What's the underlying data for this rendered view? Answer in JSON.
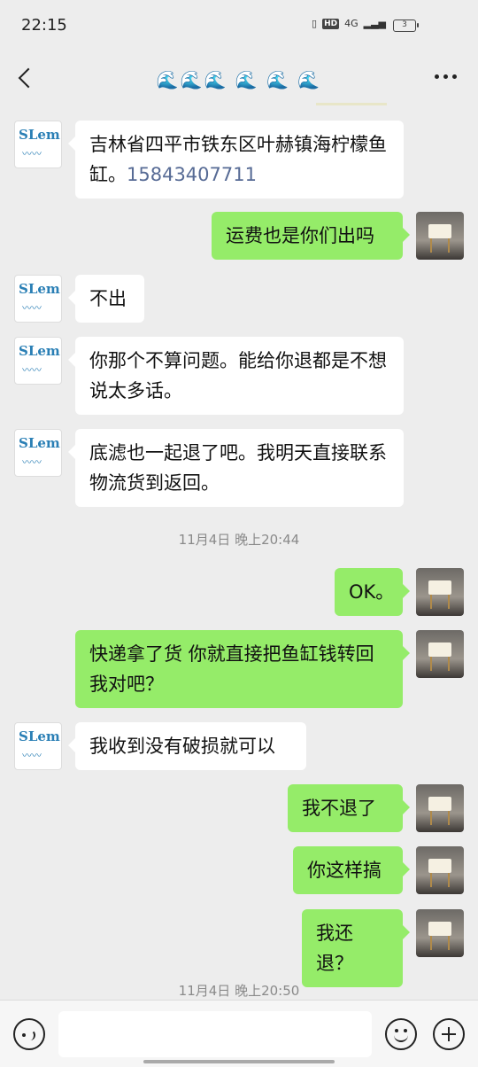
{
  "status": {
    "time": "22:15",
    "network": "4G",
    "battery": "3"
  },
  "header": {
    "title": "🌊🌊🌊 🌊 🌊 🌊"
  },
  "messages": [
    {
      "side": "left",
      "text": "吉林省四平市铁东区叶赫镇海柠檬鱼缸。",
      "link": "15843407711"
    },
    {
      "side": "right",
      "text": "运费也是你们出吗"
    },
    {
      "side": "left",
      "text": "不出"
    },
    {
      "side": "left",
      "text": "你那个不算问题。能给你退都是不想说太多话。"
    },
    {
      "side": "left",
      "text": "底滤也一起退了吧。我明天直接联系物流货到返回。"
    },
    {
      "side": "right",
      "text": "OK。"
    },
    {
      "side": "right",
      "text": "快递拿了货 你就直接把鱼缸钱转回我对吧？"
    },
    {
      "side": "left",
      "text": "我收到没有破损就可以"
    },
    {
      "side": "right",
      "text": "我不退了"
    },
    {
      "side": "right",
      "text": "你这样搞"
    },
    {
      "side": "right",
      "text": "我还退？"
    }
  ],
  "timestamps": [
    "11月4日 晚上20:44",
    "11月4日 晚上20:50"
  ],
  "avatar_text": {
    "left_logo": "SLem"
  },
  "colors": {
    "bubble_right": "#95ec69",
    "bubble_left": "#ffffff",
    "background": "#ededed",
    "link": "#576b95"
  }
}
